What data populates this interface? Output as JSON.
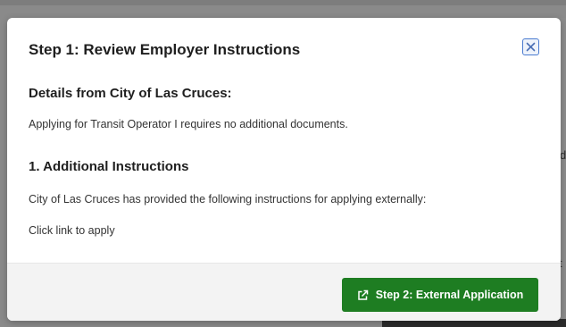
{
  "modal": {
    "title": "Step 1: Review Employer Instructions",
    "close_icon": "close-icon"
  },
  "details": {
    "heading": "Details from City of Las Cruces:",
    "text": "Applying for Transit Operator I requires no additional documents."
  },
  "instructions": {
    "heading": "1. Additional Instructions",
    "intro": "City of Las Cruces has provided the following instructions for applying externally:",
    "text": "Click link to apply"
  },
  "footer": {
    "external_button_label": "Step 2: External Application",
    "external_button_icon": "external-link-icon"
  },
  "background": {
    "glyph_1": "d",
    "glyph_2": "t"
  },
  "colors": {
    "primary_button": "#1e7d22",
    "close_button_border": "#4a7bd0",
    "overlay": "#8a8a8a"
  }
}
